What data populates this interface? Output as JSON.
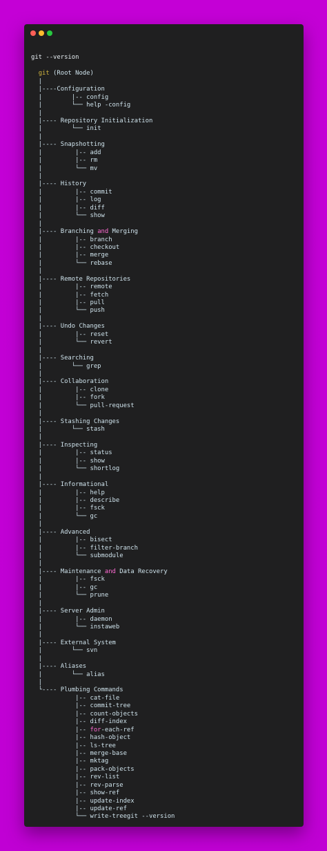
{
  "window": {
    "traffic_lights": [
      "close",
      "minimize",
      "maximize"
    ],
    "colors": {
      "close": "#fe5f57",
      "minimize": "#febc2e",
      "maximize": "#28c840",
      "background": "#1f1f20",
      "page": "#c400d6",
      "text": "#cfe3ec",
      "keyword": "#d0b43f",
      "highlight": "#ff6bd3"
    }
  },
  "code": {
    "lines": [
      {
        "text": ""
      },
      {
        "text": "git --version",
        "cls": "cmd"
      },
      {
        "text": ""
      },
      {
        "segments": [
          {
            "text": "  "
          },
          {
            "text": "git",
            "cls": "kw"
          },
          {
            "text": " (Root Node)"
          }
        ]
      },
      {
        "text": "  |"
      },
      {
        "text": "  |----Configuration"
      },
      {
        "text": "  |        |-- config"
      },
      {
        "text": "  |        └── help -config"
      },
      {
        "text": "  |"
      },
      {
        "text": "  |---- Repository Initialization"
      },
      {
        "text": "  |        └── init"
      },
      {
        "text": "  |"
      },
      {
        "text": "  |---- Snapshotting"
      },
      {
        "text": "  |         |-- add"
      },
      {
        "text": "  |         |-- rm"
      },
      {
        "text": "  |         └── mv"
      },
      {
        "text": "  |"
      },
      {
        "text": "  |---- History"
      },
      {
        "text": "  |         |-- commit"
      },
      {
        "text": "  |         |-- log"
      },
      {
        "text": "  |         |-- diff"
      },
      {
        "text": "  |         └── show"
      },
      {
        "text": "  |"
      },
      {
        "segments": [
          {
            "text": "  |---- Branching "
          },
          {
            "text": "and",
            "cls": "hl"
          },
          {
            "text": " Merging"
          }
        ]
      },
      {
        "text": "  |         |-- branch"
      },
      {
        "text": "  |         |-- checkout"
      },
      {
        "text": "  |         |-- merge"
      },
      {
        "text": "  |         └── rebase"
      },
      {
        "text": "  |"
      },
      {
        "text": "  |---- Remote Repositories"
      },
      {
        "text": "  |         |-- remote"
      },
      {
        "text": "  |         |-- fetch"
      },
      {
        "text": "  |         |-- pull"
      },
      {
        "text": "  |         └── push"
      },
      {
        "text": "  |"
      },
      {
        "text": "  |---- Undo Changes"
      },
      {
        "text": "  |         |-- reset"
      },
      {
        "text": "  |         └── revert"
      },
      {
        "text": "  |"
      },
      {
        "text": "  |---- Searching"
      },
      {
        "text": "  |        └── grep"
      },
      {
        "text": "  |"
      },
      {
        "text": "  |---- Collaboration"
      },
      {
        "text": "  |         |-- clone"
      },
      {
        "text": "  |         |-- fork"
      },
      {
        "text": "  |         └── pull-request"
      },
      {
        "text": "  |"
      },
      {
        "text": "  |---- Stashing Changes"
      },
      {
        "text": "  |        └── stash"
      },
      {
        "text": "  |"
      },
      {
        "text": "  |---- Inspecting"
      },
      {
        "text": "  |         |-- status"
      },
      {
        "text": "  |         |-- show"
      },
      {
        "text": "  |         └── shortlog"
      },
      {
        "text": "  |"
      },
      {
        "text": "  |---- Informational"
      },
      {
        "text": "  |         |-- help"
      },
      {
        "text": "  |         |-- describe"
      },
      {
        "text": "  |         |-- fsck"
      },
      {
        "text": "  |         └── gc"
      },
      {
        "text": "  |"
      },
      {
        "text": "  |---- Advanced"
      },
      {
        "text": "  |         |-- bisect"
      },
      {
        "text": "  |         |-- filter-branch"
      },
      {
        "text": "  |         └── submodule"
      },
      {
        "text": "  |"
      },
      {
        "segments": [
          {
            "text": "  |---- Maintenance "
          },
          {
            "text": "and",
            "cls": "hl"
          },
          {
            "text": " Data Recovery"
          }
        ]
      },
      {
        "text": "  |         |-- fsck"
      },
      {
        "text": "  |         |-- gc"
      },
      {
        "text": "  |         └── prune"
      },
      {
        "text": "  |"
      },
      {
        "text": "  |---- Server Admin"
      },
      {
        "text": "  |         |-- daemon"
      },
      {
        "text": "  |         └── instaweb"
      },
      {
        "text": "  |"
      },
      {
        "text": "  |---- External System"
      },
      {
        "text": "  |        └── svn"
      },
      {
        "text": "  |"
      },
      {
        "text": "  |---- Aliases"
      },
      {
        "text": "  |        └── alias"
      },
      {
        "text": "  |"
      },
      {
        "text": "  └---- Plumbing Commands"
      },
      {
        "text": "            |-- cat-file"
      },
      {
        "text": "            |-- commit-tree"
      },
      {
        "text": "            |-- count-objects"
      },
      {
        "text": "            |-- diff-index"
      },
      {
        "segments": [
          {
            "text": "            |-- "
          },
          {
            "text": "for",
            "cls": "hl"
          },
          {
            "text": "-each-ref"
          }
        ]
      },
      {
        "text": "            |-- hash-object"
      },
      {
        "text": "            |-- ls-tree"
      },
      {
        "text": "            |-- merge-base"
      },
      {
        "text": "            |-- mktag"
      },
      {
        "text": "            |-- pack-objects"
      },
      {
        "text": "            |-- rev-list"
      },
      {
        "text": "            |-- rev-parse"
      },
      {
        "text": "            |-- show-ref"
      },
      {
        "text": "            |-- update-index"
      },
      {
        "text": "            |-- update-ref"
      },
      {
        "text": "            └── write-treegit --version"
      }
    ]
  }
}
